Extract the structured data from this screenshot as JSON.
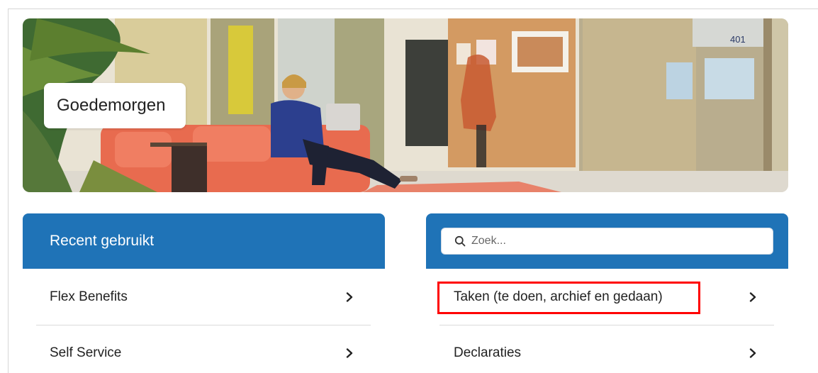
{
  "greeting": "Goedemorgen",
  "room_number": "401",
  "recent": {
    "title": "Recent gebruikt",
    "items": [
      {
        "label": "Flex Benefits"
      },
      {
        "label": "Self Service"
      }
    ]
  },
  "search": {
    "placeholder": "Zoek...",
    "items": [
      {
        "label": "Taken (te doen, archief en gedaan)"
      },
      {
        "label": "Declaraties"
      }
    ]
  },
  "colors": {
    "header_blue": "#1f73b7",
    "highlight": "#ff0000"
  },
  "icons": {
    "search": "search-icon",
    "chevron": "chevron-right-icon"
  }
}
